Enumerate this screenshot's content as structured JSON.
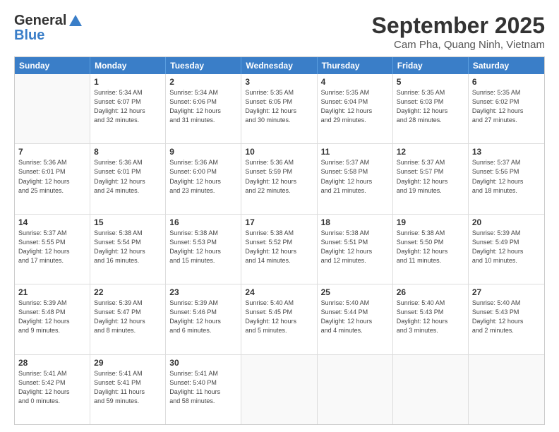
{
  "header": {
    "logo_general": "General",
    "logo_blue": "Blue",
    "title": "September 2025",
    "subtitle": "Cam Pha, Quang Ninh, Vietnam"
  },
  "days": [
    "Sunday",
    "Monday",
    "Tuesday",
    "Wednesday",
    "Thursday",
    "Friday",
    "Saturday"
  ],
  "rows": [
    [
      {
        "day": "",
        "info": ""
      },
      {
        "day": "1",
        "info": "Sunrise: 5:34 AM\nSunset: 6:07 PM\nDaylight: 12 hours\nand 32 minutes."
      },
      {
        "day": "2",
        "info": "Sunrise: 5:34 AM\nSunset: 6:06 PM\nDaylight: 12 hours\nand 31 minutes."
      },
      {
        "day": "3",
        "info": "Sunrise: 5:35 AM\nSunset: 6:05 PM\nDaylight: 12 hours\nand 30 minutes."
      },
      {
        "day": "4",
        "info": "Sunrise: 5:35 AM\nSunset: 6:04 PM\nDaylight: 12 hours\nand 29 minutes."
      },
      {
        "day": "5",
        "info": "Sunrise: 5:35 AM\nSunset: 6:03 PM\nDaylight: 12 hours\nand 28 minutes."
      },
      {
        "day": "6",
        "info": "Sunrise: 5:35 AM\nSunset: 6:02 PM\nDaylight: 12 hours\nand 27 minutes."
      }
    ],
    [
      {
        "day": "7",
        "info": "Sunrise: 5:36 AM\nSunset: 6:01 PM\nDaylight: 12 hours\nand 25 minutes."
      },
      {
        "day": "8",
        "info": "Sunrise: 5:36 AM\nSunset: 6:01 PM\nDaylight: 12 hours\nand 24 minutes."
      },
      {
        "day": "9",
        "info": "Sunrise: 5:36 AM\nSunset: 6:00 PM\nDaylight: 12 hours\nand 23 minutes."
      },
      {
        "day": "10",
        "info": "Sunrise: 5:36 AM\nSunset: 5:59 PM\nDaylight: 12 hours\nand 22 minutes."
      },
      {
        "day": "11",
        "info": "Sunrise: 5:37 AM\nSunset: 5:58 PM\nDaylight: 12 hours\nand 21 minutes."
      },
      {
        "day": "12",
        "info": "Sunrise: 5:37 AM\nSunset: 5:57 PM\nDaylight: 12 hours\nand 19 minutes."
      },
      {
        "day": "13",
        "info": "Sunrise: 5:37 AM\nSunset: 5:56 PM\nDaylight: 12 hours\nand 18 minutes."
      }
    ],
    [
      {
        "day": "14",
        "info": "Sunrise: 5:37 AM\nSunset: 5:55 PM\nDaylight: 12 hours\nand 17 minutes."
      },
      {
        "day": "15",
        "info": "Sunrise: 5:38 AM\nSunset: 5:54 PM\nDaylight: 12 hours\nand 16 minutes."
      },
      {
        "day": "16",
        "info": "Sunrise: 5:38 AM\nSunset: 5:53 PM\nDaylight: 12 hours\nand 15 minutes."
      },
      {
        "day": "17",
        "info": "Sunrise: 5:38 AM\nSunset: 5:52 PM\nDaylight: 12 hours\nand 14 minutes."
      },
      {
        "day": "18",
        "info": "Sunrise: 5:38 AM\nSunset: 5:51 PM\nDaylight: 12 hours\nand 12 minutes."
      },
      {
        "day": "19",
        "info": "Sunrise: 5:38 AM\nSunset: 5:50 PM\nDaylight: 12 hours\nand 11 minutes."
      },
      {
        "day": "20",
        "info": "Sunrise: 5:39 AM\nSunset: 5:49 PM\nDaylight: 12 hours\nand 10 minutes."
      }
    ],
    [
      {
        "day": "21",
        "info": "Sunrise: 5:39 AM\nSunset: 5:48 PM\nDaylight: 12 hours\nand 9 minutes."
      },
      {
        "day": "22",
        "info": "Sunrise: 5:39 AM\nSunset: 5:47 PM\nDaylight: 12 hours\nand 8 minutes."
      },
      {
        "day": "23",
        "info": "Sunrise: 5:39 AM\nSunset: 5:46 PM\nDaylight: 12 hours\nand 6 minutes."
      },
      {
        "day": "24",
        "info": "Sunrise: 5:40 AM\nSunset: 5:45 PM\nDaylight: 12 hours\nand 5 minutes."
      },
      {
        "day": "25",
        "info": "Sunrise: 5:40 AM\nSunset: 5:44 PM\nDaylight: 12 hours\nand 4 minutes."
      },
      {
        "day": "26",
        "info": "Sunrise: 5:40 AM\nSunset: 5:43 PM\nDaylight: 12 hours\nand 3 minutes."
      },
      {
        "day": "27",
        "info": "Sunrise: 5:40 AM\nSunset: 5:43 PM\nDaylight: 12 hours\nand 2 minutes."
      }
    ],
    [
      {
        "day": "28",
        "info": "Sunrise: 5:41 AM\nSunset: 5:42 PM\nDaylight: 12 hours\nand 0 minutes."
      },
      {
        "day": "29",
        "info": "Sunrise: 5:41 AM\nSunset: 5:41 PM\nDaylight: 11 hours\nand 59 minutes."
      },
      {
        "day": "30",
        "info": "Sunrise: 5:41 AM\nSunset: 5:40 PM\nDaylight: 11 hours\nand 58 minutes."
      },
      {
        "day": "",
        "info": ""
      },
      {
        "day": "",
        "info": ""
      },
      {
        "day": "",
        "info": ""
      },
      {
        "day": "",
        "info": ""
      }
    ]
  ]
}
